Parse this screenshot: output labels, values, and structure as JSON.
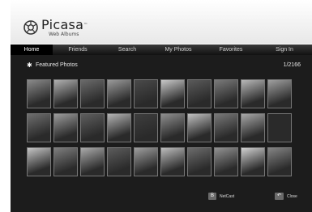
{
  "app": {
    "logo_title": "Picasa",
    "logo_tm": "™",
    "logo_subtitle": "Web Albums"
  },
  "tabs": [
    {
      "label": "Home",
      "active": true
    },
    {
      "label": "Friends",
      "active": false
    },
    {
      "label": "Search",
      "active": false
    },
    {
      "label": "My Photos",
      "active": false
    },
    {
      "label": "Favorites",
      "active": false
    },
    {
      "label": "Sign In",
      "active": false
    }
  ],
  "section": {
    "title": "Featured Photos",
    "icon": "star-icon",
    "count": "1/2166"
  },
  "photos": {
    "rows": 3,
    "cols": 10,
    "tones": [
      [
        "#8a8a8a",
        "#b0b0b0",
        "#6a6a6a",
        "#9a9a9a",
        "#4a4a4a",
        "#c8c8c8",
        "#5a5a5a",
        "#7a7a7a",
        "#b8b8b8",
        "#a0a0a0"
      ],
      [
        "#6e6e6e",
        "#9c9c9c",
        "#5e5e5e",
        "#b4b4b4",
        "#3e3e3e",
        "#8e8e8e",
        "#c0c0c0",
        "#787878",
        "#a8a8a8",
        "#2a2a2a"
      ],
      [
        "#c4c4c4",
        "#7e7e7e",
        "#aaaaaa",
        "#5c5c5c",
        "#9e9e9e",
        "#bcbcbc",
        "#6c6c6c",
        "#929292",
        "#d0d0d0",
        "#848484"
      ]
    ]
  },
  "footer": {
    "nextcast_key": "B",
    "nextcast_label": "NetCast",
    "close_key": "↶",
    "close_label": "Close"
  }
}
